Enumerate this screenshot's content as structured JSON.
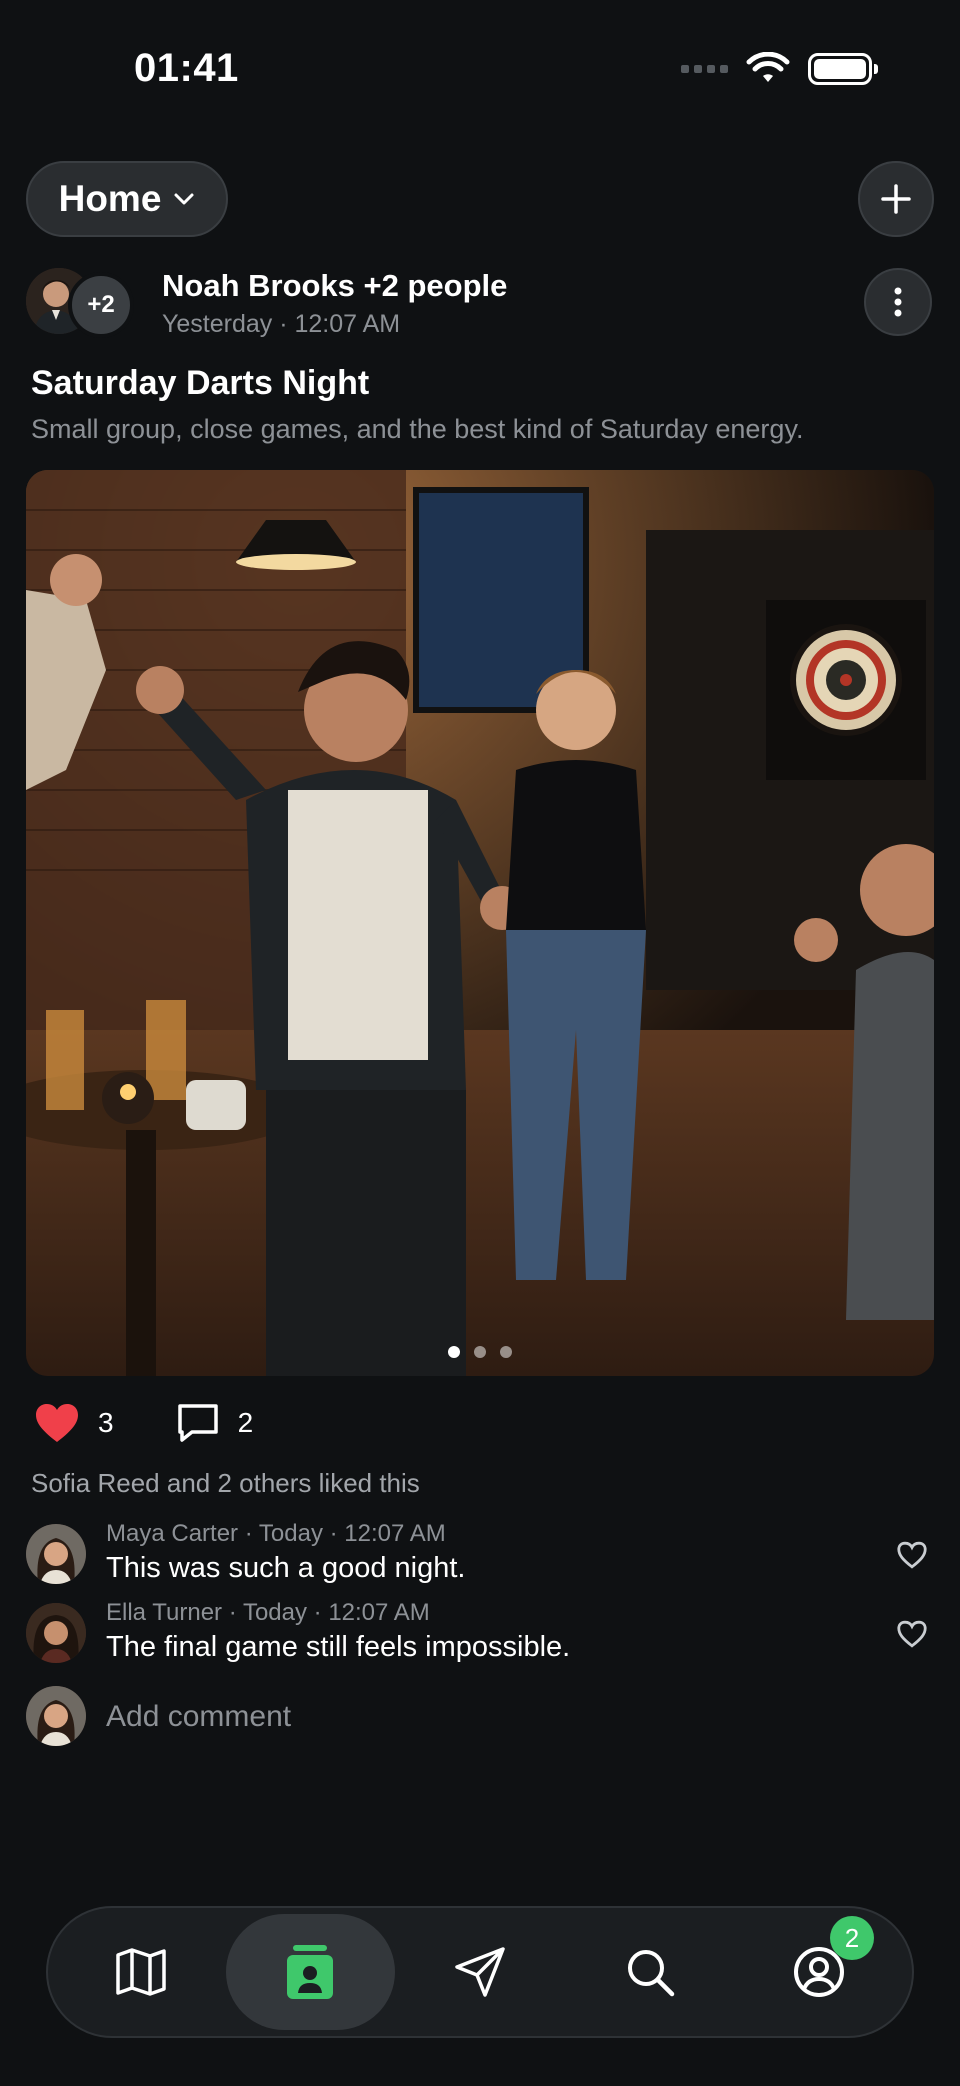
{
  "status_bar": {
    "time": "01:41"
  },
  "header": {
    "feed_selector": "Home"
  },
  "post": {
    "author": "Noah Brooks +2 people",
    "extra_people": "+2",
    "meta": "Yesterday · 12:07 AM",
    "title": "Saturday Darts Night",
    "description": "Small group, close games, and the best kind of Saturday energy.",
    "photo_count": 3,
    "photo_index": 1,
    "likes": "3",
    "comments_count": "2",
    "liked_by": "Sofia Reed and 2 others liked this",
    "liked": true
  },
  "comments": [
    {
      "meta": "Maya Carter · Today · 12:07 AM",
      "text": "This was such a good night."
    },
    {
      "meta": "Ella Turner · Today · 12:07 AM",
      "text": "The final game still feels impossible."
    }
  ],
  "add_comment": {
    "placeholder": "Add comment"
  },
  "tabbar": {
    "items": [
      {
        "icon": "map-icon"
      },
      {
        "icon": "contact-card-icon",
        "active": true
      },
      {
        "icon": "send-icon"
      },
      {
        "icon": "search-icon"
      },
      {
        "icon": "profile-icon",
        "badge": "2"
      }
    ]
  },
  "colors": {
    "accent_green": "#3fc86b",
    "like_red": "#f0404a",
    "background": "#0f1113"
  }
}
